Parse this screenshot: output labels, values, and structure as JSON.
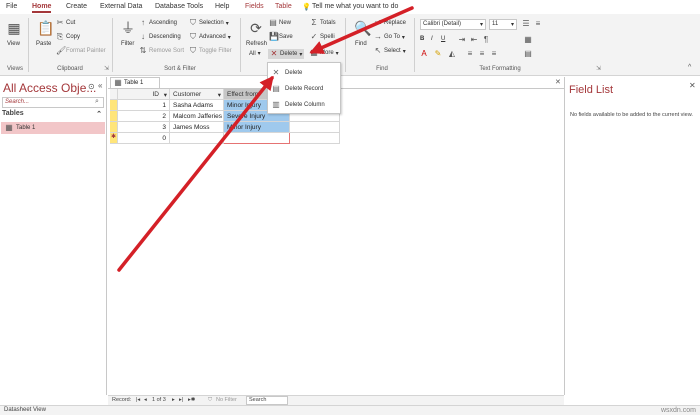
{
  "ribbon_tabs": {
    "file": "File",
    "home": "Home",
    "create": "Create",
    "external": "External Data",
    "dbtools": "Database Tools",
    "help": "Help",
    "fields": "Fields",
    "table": "Table",
    "tellme": "Tell me what you want to do"
  },
  "views_group": {
    "view_label": "View",
    "group_label": "Views"
  },
  "clipboard_group": {
    "paste": "Paste",
    "cut": "Cut",
    "copy": "Copy",
    "format_painter": "Format Painter",
    "group_label": "Clipboard"
  },
  "sort_filter_group": {
    "filter": "Filter",
    "ascending": "Ascending",
    "descending": "Descending",
    "remove_sort": "Remove Sort",
    "selection": "Selection",
    "advanced": "Advanced",
    "toggle_filter": "Toggle Filter",
    "group_label": "Sort & Filter"
  },
  "records_group": {
    "refresh": "Refresh",
    "refresh_all": "All",
    "new": "New",
    "save": "Save",
    "delete": "Delete",
    "totals": "Totals",
    "spelling": "Spelli",
    "more": "More"
  },
  "find_group": {
    "find": "Find",
    "replace": "Replace",
    "goto": "Go To",
    "select": "Select",
    "group_label": "Find"
  },
  "text_format_group": {
    "font": "Calibri (Detail)",
    "size": "11",
    "group_label": "Text Formatting"
  },
  "delete_menu": {
    "items": [
      "Delete",
      "Delete Record",
      "Delete Column"
    ]
  },
  "nav_pane": {
    "title": "All Access Obje...",
    "search_placeholder": "Search...",
    "section": "Tables",
    "item": "Table 1"
  },
  "document": {
    "tab_label": "Table 1",
    "columns": [
      "ID",
      "Customer",
      "Effect from"
    ],
    "rows": [
      [
        "1",
        "Sasha Adams",
        "Minor Injury"
      ],
      [
        "2",
        "Malcom Jafferies",
        "Severe Injury"
      ],
      [
        "3",
        "James Moss",
        "Minor Injury"
      ],
      [
        "0",
        "",
        ""
      ]
    ]
  },
  "field_list": {
    "title": "Field List",
    "message": "No fields available to be added to the current view."
  },
  "record_nav": {
    "record_label": "Record:",
    "position": "1 of 3",
    "filter": "No Filter",
    "search": "Search"
  },
  "status_bar": {
    "text": "Datasheet View"
  },
  "watermark": "wsxdn.com",
  "colors": {
    "accent": "#a4373a",
    "selection": "#9fc9ed",
    "arrow": "#d42027"
  }
}
